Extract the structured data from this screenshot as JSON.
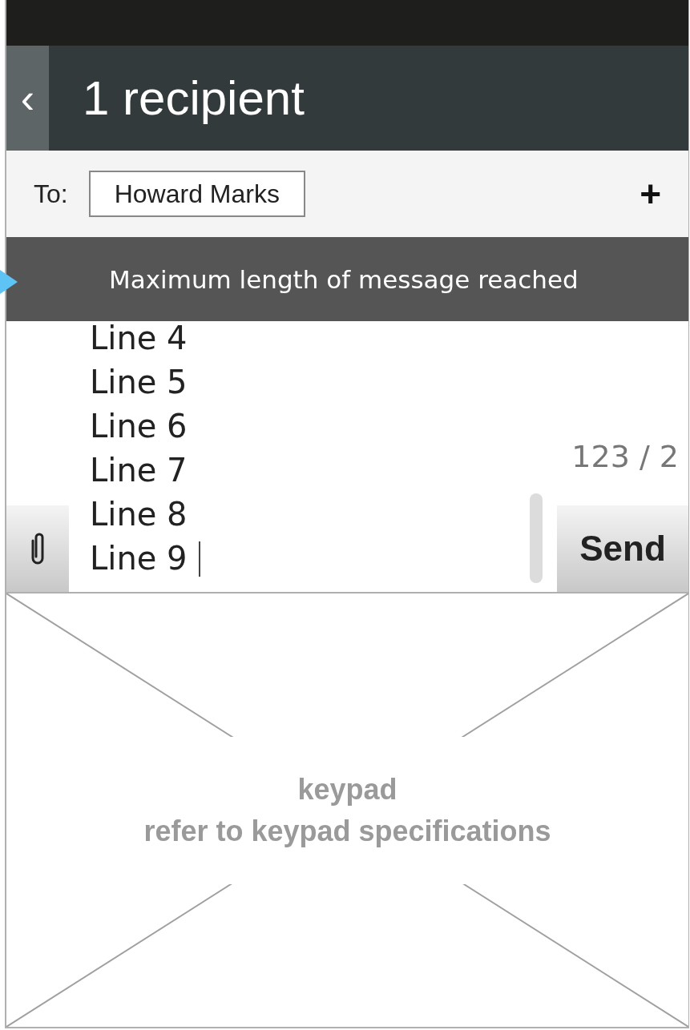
{
  "header": {
    "back": "‹",
    "title": "1 recipient"
  },
  "recipients": {
    "label": "To:",
    "chips": [
      "Howard Marks"
    ],
    "add": "+"
  },
  "toast": {
    "text": "Maximum length of message reached"
  },
  "message": {
    "lines": [
      "Line 4",
      "Line 5",
      "Line 6",
      "Line 7",
      "Line 8",
      "Line 9"
    ],
    "counter": "123 / 2",
    "send": "Send"
  },
  "keypad": {
    "lines": [
      "keypad",
      "refer to keypad specifications"
    ]
  }
}
